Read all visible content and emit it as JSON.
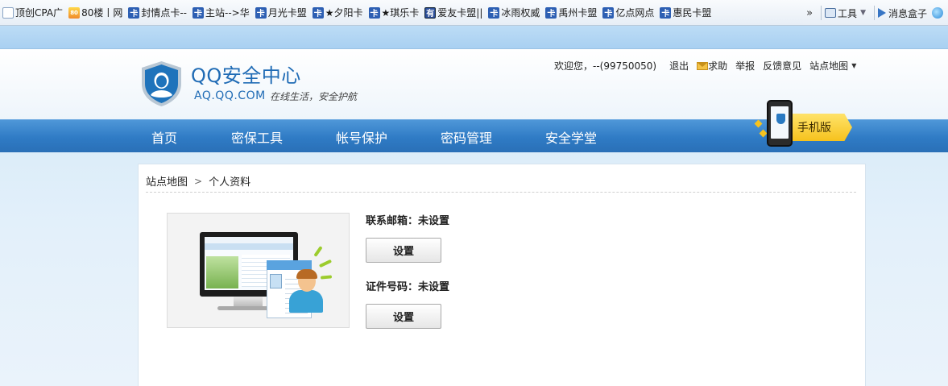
{
  "favorites_bar": {
    "items": [
      {
        "label": "顶创CPA广",
        "icon": "page-icon"
      },
      {
        "label": "80楼丨网",
        "icon": "80-icon"
      },
      {
        "label": "封情点卡--",
        "icon": "card-icon"
      },
      {
        "label": "主站-->华",
        "icon": "card-icon"
      },
      {
        "label": "月光卡盟",
        "icon": "card-icon"
      },
      {
        "label": "★夕阳卡",
        "icon": "card-icon"
      },
      {
        "label": "★琪乐卡",
        "icon": "card-icon"
      },
      {
        "label": "爱友卡盟||",
        "icon": "you-icon"
      },
      {
        "label": "冰雨权威",
        "icon": "card-icon"
      },
      {
        "label": "禹州卡盟",
        "icon": "card-icon"
      },
      {
        "label": "亿点网点",
        "icon": "card-icon"
      },
      {
        "label": "惠民卡盟",
        "icon": "card-icon"
      }
    ],
    "card_icon_glyph": "卡",
    "you_icon_glyph": "有",
    "eighty_icon_glyph": "80",
    "overflow_glyph": "»",
    "tools_label": "工具",
    "tools_caret": "▼",
    "messagebox_label": "消息盒子"
  },
  "site": {
    "title": "QQ安全中心",
    "domain": "AQ.QQ.COM",
    "slogan": "在线生活，安全护航",
    "accent_color": "#1f6bb5"
  },
  "top_nav": {
    "welcome": "欢迎您，--(99750050)",
    "logout": "退出",
    "help": "求助",
    "report": "举报",
    "feedback": "反馈意见",
    "sitemap": "站点地图",
    "sitemap_caret": "▼"
  },
  "main_nav": {
    "items": [
      "首页",
      "密保工具",
      "帐号保护",
      "密码管理",
      "安全学堂"
    ],
    "bar_color": "#2f7bc5"
  },
  "mobile_badge": {
    "label": "手机版"
  },
  "breadcrumb": {
    "root": "站点地图",
    "separator": ">",
    "current": "个人资料"
  },
  "profile": {
    "email_label": "联系邮箱：未设置",
    "email_button": "设置",
    "id_label": "证件号码：未设置",
    "id_button": "设置"
  }
}
